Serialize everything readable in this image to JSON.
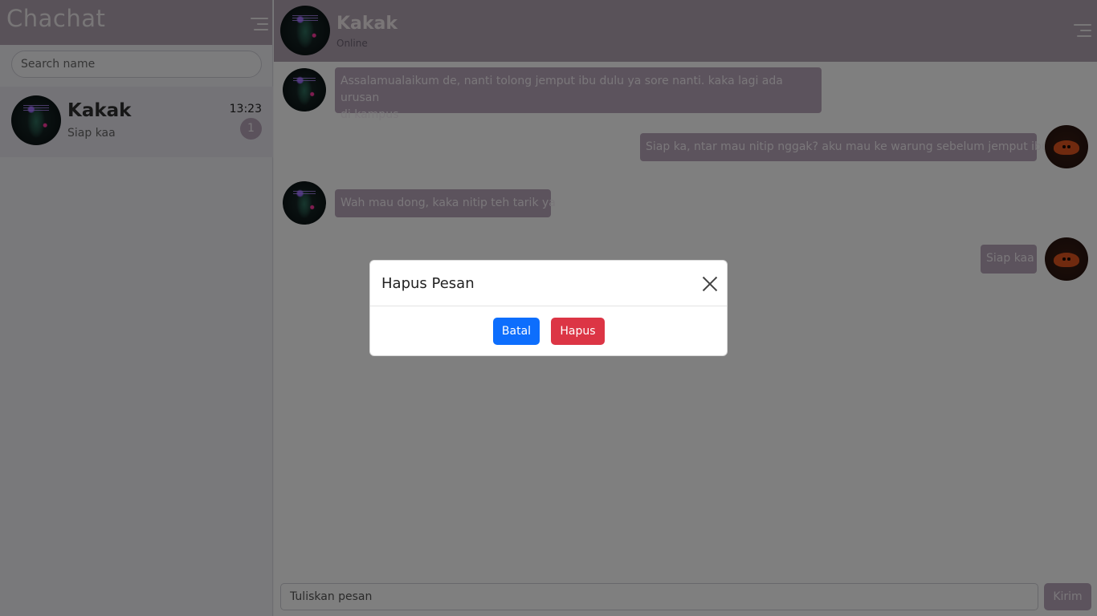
{
  "app": {
    "brand": "Chachat"
  },
  "sidebar": {
    "search_placeholder": "Search name",
    "contacts": [
      {
        "name": "Kakak",
        "last_message": "Siap kaa",
        "time": "13:23",
        "unread": "1"
      }
    ]
  },
  "chat": {
    "contact_name": "Kakak",
    "status": "Online",
    "messages": [
      {
        "side": "received",
        "text_line1": "Assalamualaikum de, nanti tolong jemput ibu dulu ya sore nanti. kaka lagi ada urusan",
        "text_line2": "di kampus"
      },
      {
        "side": "sent",
        "text": "Siap ka, ntar mau nitip nggak? aku mau ke warung sebelum jemput ibu"
      },
      {
        "side": "received",
        "text": "Wah mau dong, kaka nitip teh tarik ya"
      },
      {
        "side": "sent",
        "text": "Siap kaa"
      }
    ],
    "composer": {
      "placeholder": "Tuliskan pesan",
      "send_label": "Kirim"
    }
  },
  "modal": {
    "title": "Hapus Pesan",
    "cancel_label": "Batal",
    "delete_label": "Hapus"
  },
  "colors": {
    "header": "#b2a4b2",
    "bubble": "#b9a7bb",
    "primary_button": "#0d6efd",
    "danger_button": "#dc3545"
  }
}
